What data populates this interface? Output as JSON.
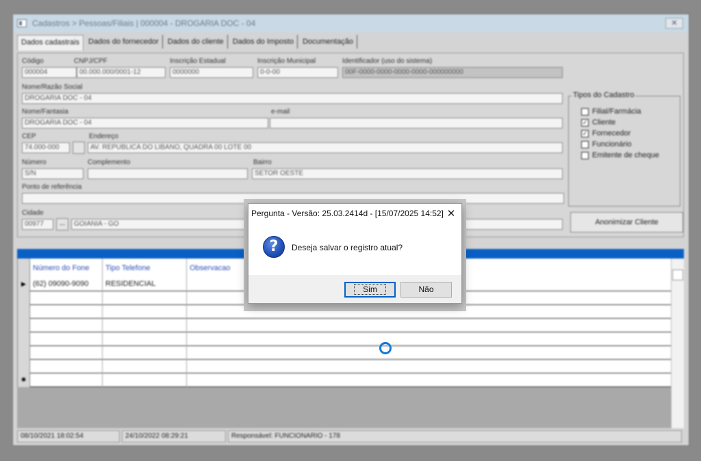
{
  "window": {
    "title": "Cadastros > Pessoas/Filiais | 000004 - DROGARIA DOC - 04",
    "close_label": "✕"
  },
  "tabs": [
    {
      "label": "Dados cadastrais"
    },
    {
      "label": "Dados do fornecedor"
    },
    {
      "label": "Dados do cliente"
    },
    {
      "label": "Dados do Imposto"
    },
    {
      "label": "Documentação"
    }
  ],
  "form": {
    "codigo_label": "Código",
    "codigo_value": "000004",
    "cpf_label": "CNPJ/CPF",
    "cpf_value": "00.000.000/0001-12",
    "ie_label": "Inscrição Estadual",
    "ie_value": "0000000",
    "im_label": "Inscrição Municipal",
    "im_value": "0-0-00",
    "ident_label": "Identificador (uso do sistema)",
    "ident_value": "00F-0000-0000-0000-0000-000000000",
    "razao_label": "Nome/Razão Social",
    "razao_value": "DROGARIA DOC - 04",
    "fantasia_label": "Nome/Fantasia",
    "fantasia_value": "DROGARIA DOC - 04",
    "email_label": "e-mail",
    "email_value": "",
    "cep_label": "CEP",
    "cep_value": "74.000-000",
    "endereco_label": "Endereço",
    "endereco_value": "AV. REPUBLICA DO LIBANO, QUADRA 00 LOTE 00",
    "numero_label": "Número",
    "numero_value": "S/N",
    "complemento_label": "Complemento",
    "complemento_value": "",
    "bairro_label": "Bairro",
    "bairro_value": "SETOR OESTE",
    "referencia_label": "Ponto de referência",
    "referencia_value": "",
    "cidade_label": "Cidade",
    "cidade_code": "00977",
    "cidade_lookup": "...",
    "cidade_value": "GOIANIA - GO"
  },
  "tipos": {
    "title": "Tipos do Cadastro",
    "items": [
      {
        "label": "Filial/Farmácia",
        "checked": false,
        "mark": ""
      },
      {
        "label": "Cliente",
        "checked": true,
        "mark": "✓"
      },
      {
        "label": "Fornecedor",
        "checked": true,
        "mark": "✓"
      },
      {
        "label": "Funcionário",
        "checked": false,
        "mark": ""
      },
      {
        "label": "Emitente de cheque",
        "checked": false,
        "mark": ""
      }
    ]
  },
  "anonimizar_label": "Anonimizar Cliente",
  "grid": {
    "headers": [
      "Número do Fone",
      "Tipo Telefone",
      "Observacao"
    ],
    "rows": [
      {
        "indicator": "▶",
        "fone": "(62) 09090-9090",
        "tipo": "RESIDENCIAL",
        "obs": ""
      }
    ],
    "new_row_indicator": "✱"
  },
  "status": {
    "created": "08/10/2021 18:02:54",
    "updated": "24/10/2022 08:29:21",
    "responsavel": "Responsável: FUNCIONARIO - 178"
  },
  "dialog": {
    "title": "Pergunta - Versão: 25.03.2414d - [15/07/2025 14:52]",
    "close": "✕",
    "icon": "?",
    "message": "Deseja salvar o registro atual?",
    "yes_label": "Sim",
    "no_label": "Não"
  }
}
